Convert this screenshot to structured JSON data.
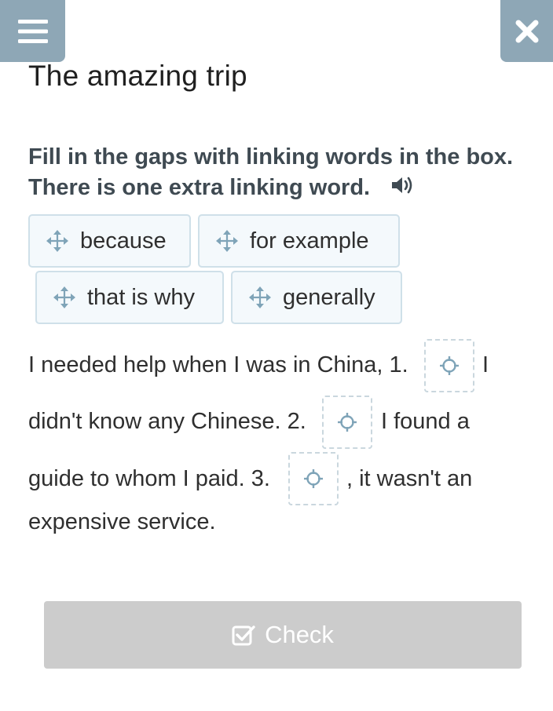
{
  "header": {
    "title": "The amazing trip"
  },
  "instruction": {
    "line1": "Fill in the gaps with linking words in the box.",
    "line2": "There is one extra linking word."
  },
  "word_bank": [
    {
      "label": "because"
    },
    {
      "label": "for example"
    },
    {
      "label": "that is why"
    },
    {
      "label": "generally"
    }
  ],
  "text": {
    "line1_before": "I needed help when I was in China, 1.",
    "line1_after": "I",
    "line2_before": "didn't know any Chinese. 2.",
    "line2_after": "I found a",
    "line3_before": "guide to whom I paid. 3.",
    "line3_after": ", it wasn't an",
    "line4": "expensive service."
  },
  "footer": {
    "check_label": "Check"
  },
  "colors": {
    "corner_button": "#8ea7b6",
    "chip_border": "#cfe0e9",
    "chip_bg": "#f4f9fc",
    "check_button": "#cccccc"
  }
}
